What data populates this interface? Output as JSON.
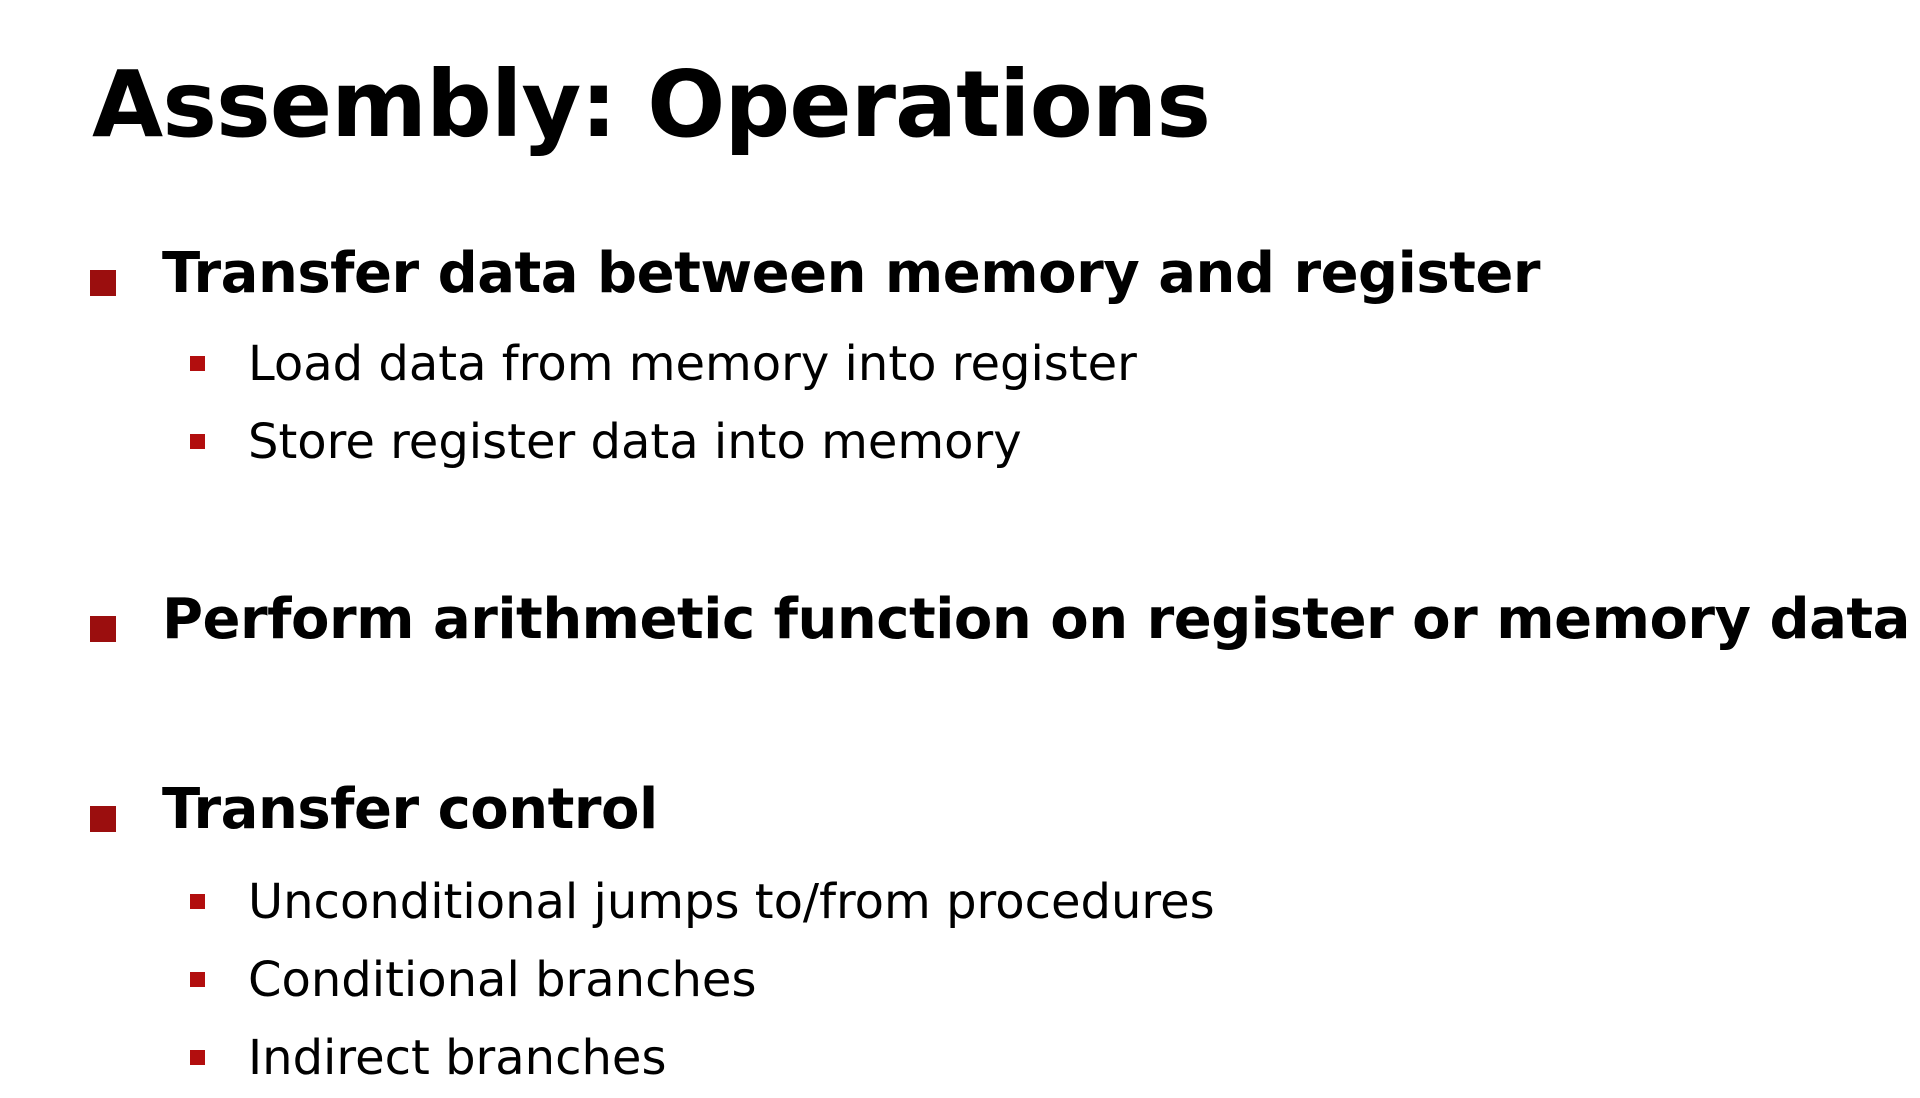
{
  "slide": {
    "title": "Assembly: Operations",
    "accent_color": "#9b0e0e",
    "bullets": [
      {
        "text": "Transfer data between memory and register",
        "subitems": [
          {
            "text": "Load data from memory into register"
          },
          {
            "text": "Store register data into memory"
          }
        ]
      },
      {
        "text": "Perform arithmetic function on register or memory data",
        "subitems": []
      },
      {
        "text": "Transfer control",
        "subitems": [
          {
            "text": "Unconditional jumps to/from procedures"
          },
          {
            "text": "Conditional branches"
          },
          {
            "text": "Indirect branches"
          }
        ]
      }
    ]
  }
}
